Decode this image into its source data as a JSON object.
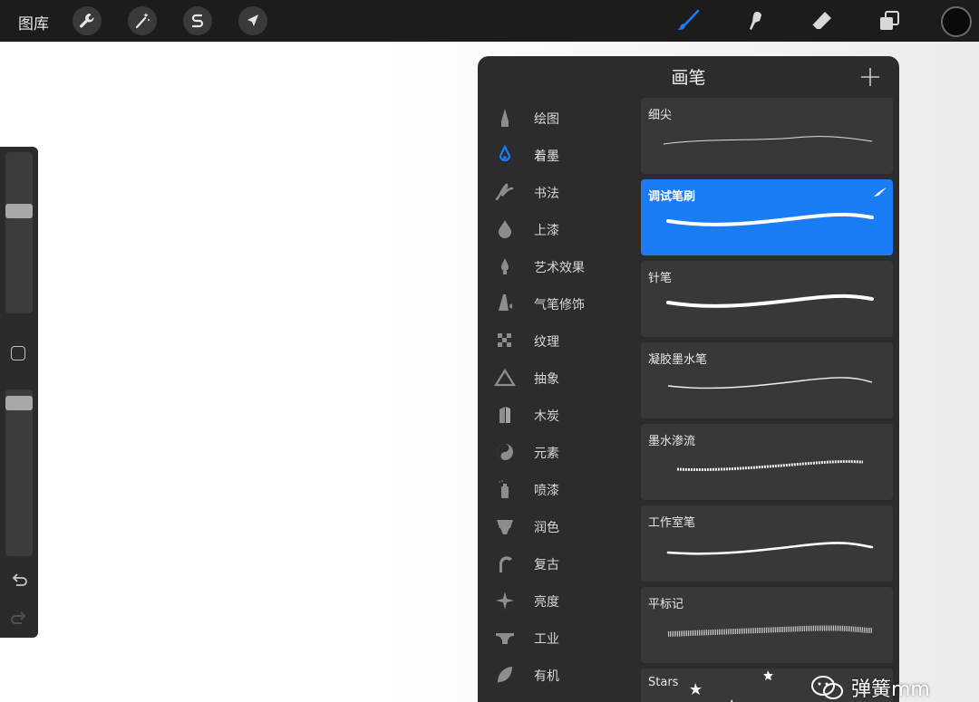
{
  "topbar": {
    "gallery_label": "图库",
    "left_tools": [
      {
        "icon": "wrench-icon"
      },
      {
        "icon": "magic-wand-icon"
      },
      {
        "icon": "selection-s-icon"
      },
      {
        "icon": "transform-arrow-icon"
      }
    ],
    "right_tools": [
      {
        "icon": "brush-icon",
        "active": true
      },
      {
        "icon": "smudge-icon"
      },
      {
        "icon": "eraser-icon"
      },
      {
        "icon": "layers-icon"
      },
      {
        "icon": "color-well"
      }
    ],
    "accent_color": "#1a7cf5"
  },
  "sidebar": {
    "size_slider_level": 0.65,
    "opacity_slider_level": 0.96,
    "modify_icon": "square-icon",
    "undo_icon": "undo-icon",
    "redo_icon": "redo-icon"
  },
  "panel": {
    "title": "画笔",
    "add_icon": "plus-icon",
    "categories": [
      {
        "label": "绘图",
        "icon": "pencil-tip-icon"
      },
      {
        "label": "着墨",
        "icon": "ink-drop-icon",
        "active": true
      },
      {
        "label": "书法",
        "icon": "calligraphy-icon"
      },
      {
        "label": "上漆",
        "icon": "paint-drop-icon"
      },
      {
        "label": "艺术效果",
        "icon": "artistic-drop-icon"
      },
      {
        "label": "气笔修饰",
        "icon": "airbrush-icon"
      },
      {
        "label": "纹理",
        "icon": "texture-icon"
      },
      {
        "label": "抽象",
        "icon": "triangle-icon"
      },
      {
        "label": "木炭",
        "icon": "charcoal-icon"
      },
      {
        "label": "元素",
        "icon": "yin-yang-icon"
      },
      {
        "label": "喷漆",
        "icon": "spray-can-icon"
      },
      {
        "label": "润色",
        "icon": "touchup-icon"
      },
      {
        "label": "复古",
        "icon": "retro-icon"
      },
      {
        "label": "亮度",
        "icon": "sparkle-icon"
      },
      {
        "label": "工业",
        "icon": "anvil-icon"
      },
      {
        "label": "有机",
        "icon": "leaf-icon"
      }
    ],
    "brushes": [
      {
        "name": "细尖"
      },
      {
        "name": "调试笔刷",
        "selected": true
      },
      {
        "name": "针笔"
      },
      {
        "name": "凝胶墨水笔"
      },
      {
        "name": "墨水渗流"
      },
      {
        "name": "工作室笔"
      },
      {
        "name": "平标记"
      },
      {
        "name": "Stars"
      }
    ]
  },
  "watermark": {
    "text": "弹簧mm",
    "icon": "wechat-icon"
  }
}
